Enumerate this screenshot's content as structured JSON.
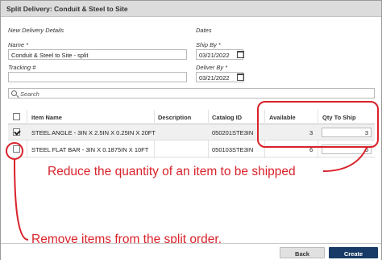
{
  "dialog": {
    "title": "Split Delivery: Conduit & Steel to Site"
  },
  "sections": {
    "new_delivery": "New Delivery Details",
    "dates": "Dates"
  },
  "fields": {
    "name_label": "Name *",
    "name_value": "Conduit & Steel to Site - split",
    "tracking_label": "Tracking #",
    "tracking_value": "",
    "ship_by_label": "Ship By *",
    "ship_by_value": "03/21/2022",
    "deliver_by_label": "Deliver By *",
    "deliver_by_value": "03/21/2022"
  },
  "search": {
    "placeholder": "Search",
    "icon": "search-icon"
  },
  "table": {
    "columns": [
      "Item Name",
      "Description",
      "Catalog ID",
      "Available",
      "Qty To Ship"
    ],
    "rows": [
      {
        "checked": true,
        "item_name": "STEEL ANGLE - 3IN X 2.5IN X 0.25IN X 20FT",
        "description": "",
        "catalog_id": "050201STE3IN",
        "available": "3",
        "qty_to_ship": "3"
      },
      {
        "checked": false,
        "item_name": "STEEL FLAT BAR - 3IN X 0.1875IN X 10FT",
        "description": "",
        "catalog_id": "050103STE3IN",
        "available": "6",
        "qty_to_ship": "0"
      }
    ]
  },
  "annotations": {
    "qty_note": "Reduce the quantity of an item to be shipped",
    "remove_note": "Remove items from the split order.",
    "color": "#d9222a"
  },
  "footer": {
    "back_label": "Back",
    "create_label": "Create",
    "create_color": "#173a66"
  }
}
